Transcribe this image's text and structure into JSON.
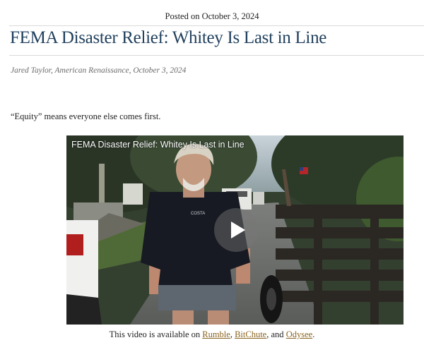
{
  "post": {
    "posted_date": "Posted on October 3, 2024",
    "title": "FEMA Disaster Relief: Whitey Is Last in Line",
    "byline": "Jared Taylor, American Renaissance, October 3, 2024",
    "lede": "“Equity” means everyone else comes first."
  },
  "video": {
    "title": "FEMA Disaster Relief: Whitey Is Last in Line",
    "shirt_logo_text": "COSTA",
    "play_icon": "play-icon"
  },
  "availability": {
    "prefix": "This video is available on ",
    "rumble": "Rumble",
    "sep1": ", ",
    "bitchute": "BitChute",
    "sep2": ", and ",
    "odysee": "Odysee",
    "suffix": "."
  },
  "colors": {
    "title": "#1f3f5c",
    "link": "#8a6420",
    "byline": "#6b6b6b"
  }
}
